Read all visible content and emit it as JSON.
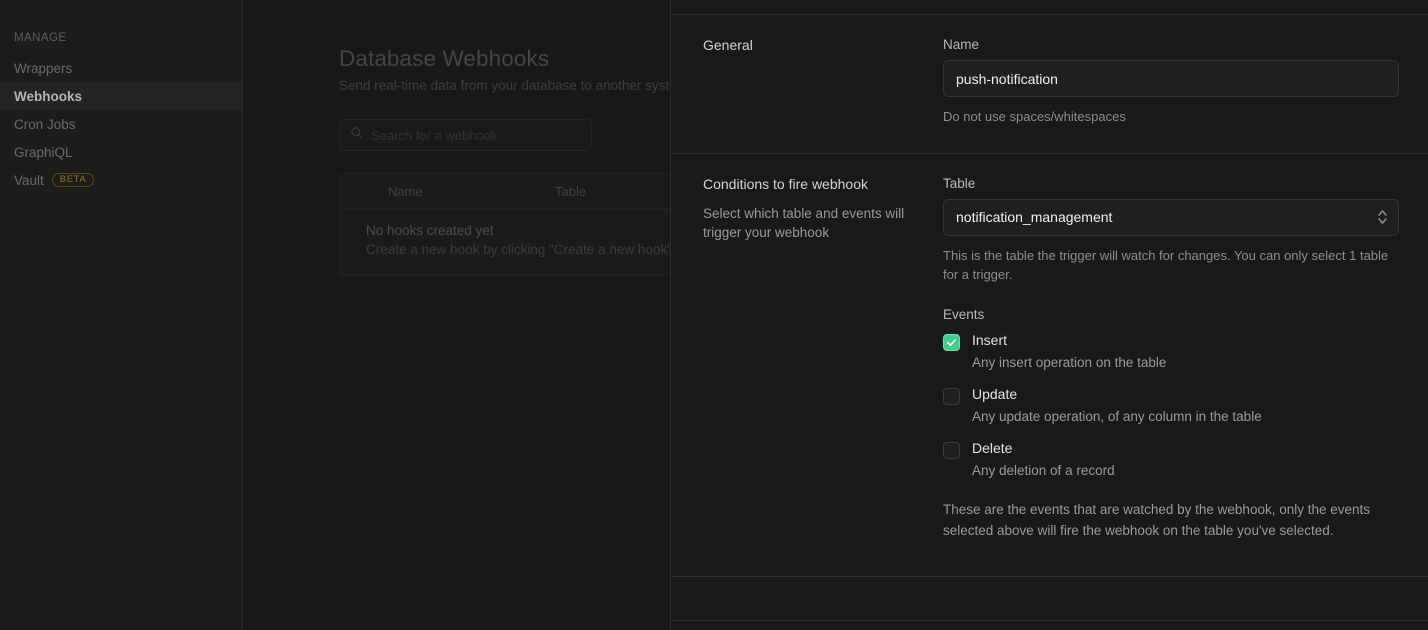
{
  "sidebar": {
    "heading": "MANAGE",
    "items": [
      {
        "label": "Wrappers",
        "active": false
      },
      {
        "label": "Webhooks",
        "active": true
      },
      {
        "label": "Cron Jobs",
        "active": false
      },
      {
        "label": "GraphiQL",
        "active": false
      },
      {
        "label": "Vault",
        "active": false,
        "badge": "BETA"
      }
    ]
  },
  "main": {
    "title": "Database Webhooks",
    "subtitle": "Send real-time data from your database to another system whenever a table event occurs",
    "search": {
      "placeholder": "Search for a webhook",
      "value": "",
      "icon": "search-icon"
    },
    "table": {
      "columns": [
        "Name",
        "Table"
      ],
      "empty_title": "No hooks created yet",
      "empty_subtitle": "Create a new hook by clicking \"Create a new hook\""
    }
  },
  "panel": {
    "general": {
      "title": "General",
      "name_label": "Name",
      "name_value": "push-notification",
      "name_hint": "Do not use spaces/whitespaces"
    },
    "conditions": {
      "title": "Conditions to fire webhook",
      "description": "Select which table and events will trigger your webhook",
      "table_label": "Table",
      "table_value": "notification_management",
      "table_hint": "This is the table the trigger will watch for changes. You can only select 1 table for a trigger.",
      "events_label": "Events",
      "events": [
        {
          "name": "Insert",
          "description": "Any insert operation on the table",
          "checked": true
        },
        {
          "name": "Update",
          "description": "Any update operation, of any column in the table",
          "checked": false
        },
        {
          "name": "Delete",
          "description": "Any deletion of a record",
          "checked": false
        }
      ],
      "events_hint": "These are the events that are watched by the webhook, only the events selected above will fire the webhook on the table you've selected."
    }
  },
  "colors": {
    "accent_green": "#3ecf8e",
    "beta_amber": "#9a7320",
    "panel_bg": "#191919",
    "app_bg": "#181818"
  }
}
